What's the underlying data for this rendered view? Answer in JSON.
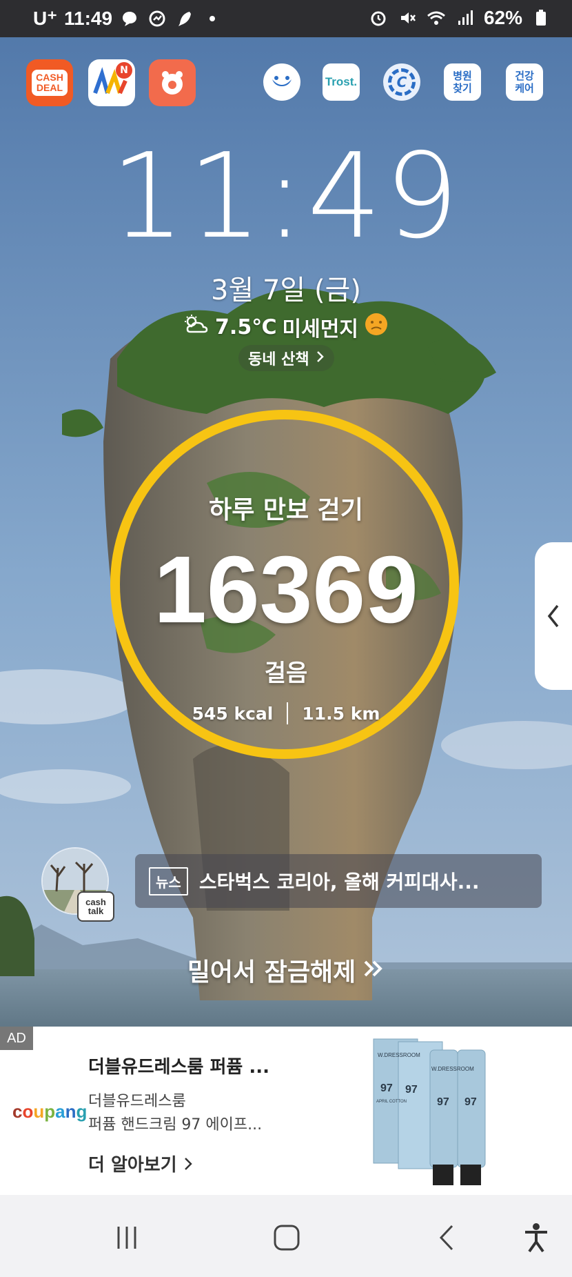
{
  "status_bar": {
    "carrier": "U⁺",
    "time": "11:49",
    "battery": "62%",
    "icons_left": [
      "talk-bubble-icon",
      "chart-icon",
      "feather-icon",
      "dot-icon"
    ],
    "icons_right": [
      "alarm-icon",
      "mute-icon",
      "wifi-icon",
      "signal-icon",
      "battery-icon"
    ]
  },
  "apps_left": [
    {
      "name": "cash-deal",
      "label_line1": "CASH",
      "label_line2": "DEAL",
      "color": "#f15a24"
    },
    {
      "name": "app-n",
      "badge": "N",
      "color": "#ffffff"
    },
    {
      "name": "paw-app",
      "color": "#f26b4c"
    }
  ],
  "apps_right": [
    {
      "name": "whale-app",
      "label": ""
    },
    {
      "name": "trost-app",
      "label": "Trost."
    },
    {
      "name": "c-app",
      "label": "C"
    },
    {
      "name": "hospital-app",
      "label_line1": "병원",
      "label_line2": "찾기"
    },
    {
      "name": "health-app",
      "label_line1": "건강",
      "label_line2": "케어"
    }
  ],
  "lock": {
    "clock": "11:49",
    "date": "3월 7일 (금)",
    "temperature": "7.5℃",
    "dust_label": "미세먼지",
    "walk_link": "동네 산책"
  },
  "steps": {
    "title": "하루 만보 걷기",
    "count": "16369",
    "unit": "걸음",
    "kcal": "545 kcal",
    "distance": "11.5 km",
    "ring_color": "#f7c413"
  },
  "cashtalk": {
    "line1": "cash",
    "line2": "talk"
  },
  "news": {
    "tag": "뉴스",
    "headline": "스타벅스 코리아, 올해 커피대사..."
  },
  "unlock": {
    "label": "밀어서 잠금해제"
  },
  "ad": {
    "tag": "AD",
    "advertiser": "coupang",
    "title": "더블유드레스룸 퍼퓸 ...",
    "brand": "더블유드레스룸",
    "description": "퍼퓸 핸드크림 97 에이프...",
    "more": "더 알아보기"
  },
  "product": {
    "brand": "W.DRESSROOM",
    "number": "97",
    "variant": "APRIL COTTON"
  },
  "navbar": [
    "recents-button",
    "home-button",
    "back-button",
    "accessibility-button"
  ]
}
